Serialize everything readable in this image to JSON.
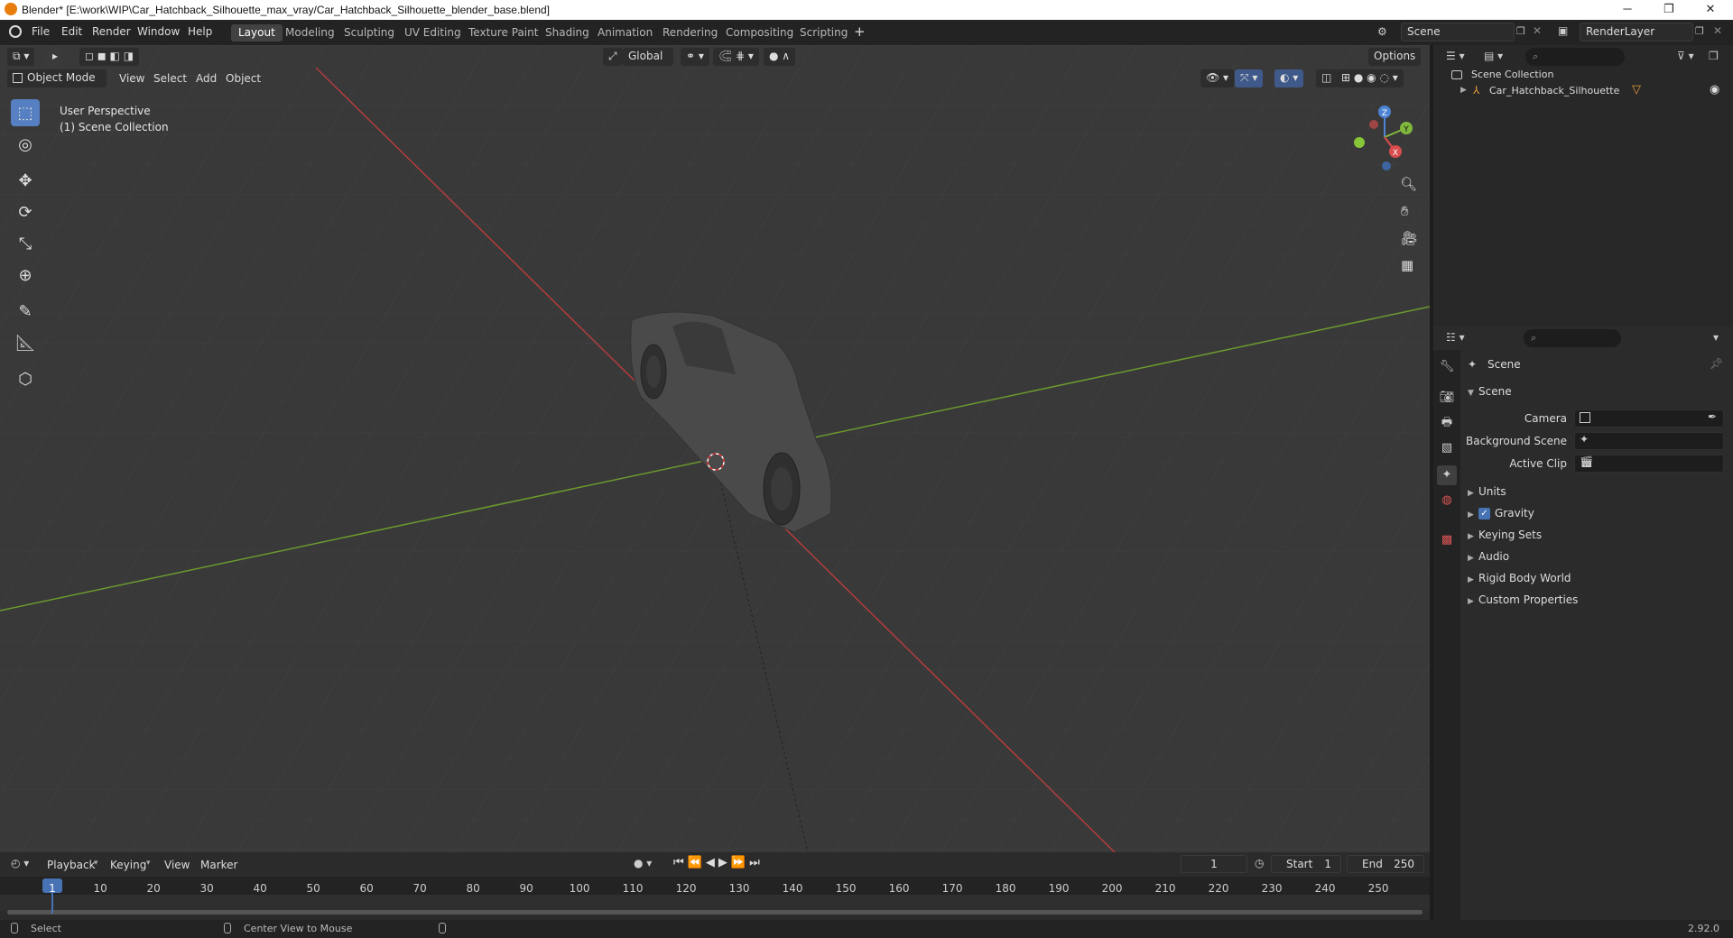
{
  "window": {
    "title": "Blender* [E:\\work\\WIP\\Car_Hatchback_Silhouette_max_vray/Car_Hatchback_Silhouette_blender_base.blend]",
    "minimize": "─",
    "maximize": "❐",
    "close": "✕"
  },
  "menu": [
    "File",
    "Edit",
    "Render",
    "Window",
    "Help"
  ],
  "workspaces": [
    "Layout",
    "Modeling",
    "Sculpting",
    "UV Editing",
    "Texture Paint",
    "Shading",
    "Animation",
    "Rendering",
    "Compositing",
    "Scripting"
  ],
  "active_workspace": "Layout",
  "scene_field": "Scene",
  "renderlayer_field": "RenderLayer",
  "viewport_header": {
    "transform_orientation": "Global",
    "options": "Options",
    "mode": "Object Mode",
    "menus": [
      "View",
      "Select",
      "Add",
      "Object"
    ]
  },
  "viewport_overlay": {
    "perspective": "User Perspective",
    "collection": "(1) Scene Collection"
  },
  "gizmo": {
    "x": "X",
    "y": "Y",
    "z": "Z"
  },
  "outliner": {
    "root": "Scene Collection",
    "items": [
      {
        "label": "Car_Hatchback_Silhouette"
      }
    ]
  },
  "properties": {
    "breadcrumb": "Scene",
    "panel_title": "Scene",
    "fields": [
      {
        "label": "Camera"
      },
      {
        "label": "Background Scene"
      },
      {
        "label": "Active Clip"
      }
    ],
    "sections": [
      "Units",
      "Gravity",
      "Keying Sets",
      "Audio",
      "Rigid Body World",
      "Custom Properties"
    ],
    "gravity_checked": true
  },
  "timeline": {
    "menus": [
      "Playback",
      "Keying",
      "View",
      "Marker"
    ],
    "current_frame": "1",
    "start_label": "Start",
    "start_value": "1",
    "end_label": "End",
    "end_value": "250",
    "frames": [
      "1",
      "10",
      "20",
      "30",
      "40",
      "50",
      "60",
      "70",
      "80",
      "90",
      "100",
      "110",
      "120",
      "130",
      "140",
      "150",
      "160",
      "170",
      "180",
      "190",
      "200",
      "210",
      "220",
      "230",
      "240",
      "250"
    ]
  },
  "statusbar": {
    "left": "Select",
    "middle": "Center View to Mouse",
    "version": "2.92.0"
  }
}
